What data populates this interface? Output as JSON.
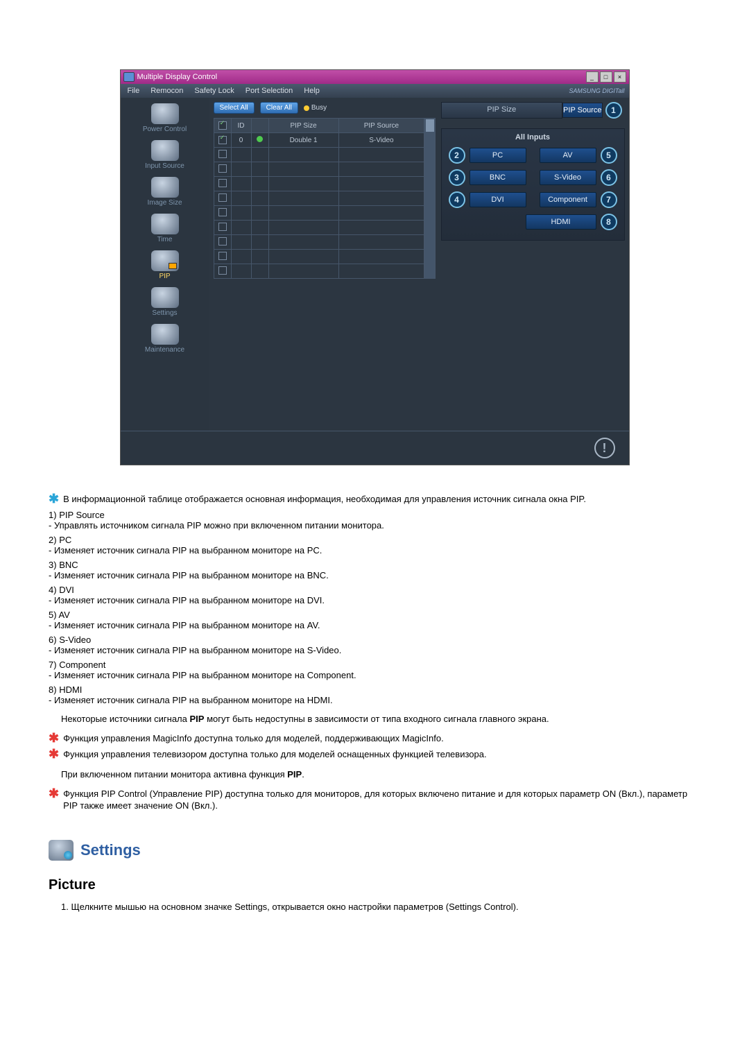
{
  "app_window": {
    "title": "Multiple Display Control",
    "menus": [
      "File",
      "Remocon",
      "Safety Lock",
      "Port Selection",
      "Help"
    ],
    "brand_logo": "SAMSUNG DIGITall",
    "top_buttons": {
      "select_all": "Select All",
      "clear_all": "Clear All",
      "busy": "Busy"
    },
    "sidebar": [
      {
        "label": "Power Control",
        "active": false
      },
      {
        "label": "Input Source",
        "active": false
      },
      {
        "label": "Image Size",
        "active": false
      },
      {
        "label": "Time",
        "active": false
      },
      {
        "label": "PIP",
        "active": true
      },
      {
        "label": "Settings",
        "active": false
      },
      {
        "label": "Maintenance",
        "active": false
      }
    ],
    "table": {
      "cols": [
        "",
        "ID",
        "",
        "PIP Size",
        "PIP Source"
      ],
      "rows": [
        {
          "checked": true,
          "id": "0",
          "status": "green",
          "pip_size": "Double 1",
          "pip_source": "S-Video"
        },
        {
          "checked": false,
          "id": "",
          "status": "",
          "pip_size": "",
          "pip_source": ""
        },
        {
          "checked": false,
          "id": "",
          "status": "",
          "pip_size": "",
          "pip_source": ""
        },
        {
          "checked": false,
          "id": "",
          "status": "",
          "pip_size": "",
          "pip_source": ""
        },
        {
          "checked": false,
          "id": "",
          "status": "",
          "pip_size": "",
          "pip_source": ""
        },
        {
          "checked": false,
          "id": "",
          "status": "",
          "pip_size": "",
          "pip_source": ""
        },
        {
          "checked": false,
          "id": "",
          "status": "",
          "pip_size": "",
          "pip_source": ""
        },
        {
          "checked": false,
          "id": "",
          "status": "",
          "pip_size": "",
          "pip_source": ""
        },
        {
          "checked": false,
          "id": "",
          "status": "",
          "pip_size": "",
          "pip_source": ""
        },
        {
          "checked": false,
          "id": "",
          "status": "",
          "pip_size": "",
          "pip_source": ""
        }
      ]
    },
    "tabs": {
      "pip_size": "PIP Size",
      "pip_source": "PIP Source"
    },
    "callouts": {
      "pip_source_tab": "1",
      "pc": "2",
      "bnc": "3",
      "dvi": "4",
      "av": "5",
      "svideo": "6",
      "component": "7",
      "hdmi": "8"
    },
    "inputs_panel": {
      "title": "All Inputs",
      "left": [
        "PC",
        "BNC",
        "DVI"
      ],
      "right": [
        "AV",
        "S-Video",
        "Component",
        "HDMI"
      ]
    }
  },
  "doc": {
    "intro_note": "В информационной таблице отображается основная информация, необходимая для управления источник сигнала окна PIP.",
    "items": [
      {
        "n": "1)",
        "title": "PIP Source",
        "desc": "- Управлять источником сигнала PIP можно при включенном питании монитора."
      },
      {
        "n": "2)",
        "title": "PC",
        "desc": "- Изменяет источник сигнала PIP на выбранном мониторе на PC."
      },
      {
        "n": "3)",
        "title": "BNC",
        "desc": "- Изменяет источник сигнала PIP на выбранном мониторе на BNC."
      },
      {
        "n": "4)",
        "title": "DVI",
        "desc": "- Изменяет источник сигнала PIP на выбранном мониторе на DVI."
      },
      {
        "n": "5)",
        "title": "AV",
        "desc": "- Изменяет источник сигнала PIP на выбранном мониторе на AV."
      },
      {
        "n": "6)",
        "title": "S-Video",
        "desc": "- Изменяет источник сигнала PIP на выбранном мониторе на S-Video."
      },
      {
        "n": "7)",
        "title": "Component",
        "desc": "- Изменяет источник сигнала PIP на выбранном мониторе на Component."
      },
      {
        "n": "8)",
        "title": "HDMI",
        "desc": "- Изменяет источник сигнала PIP на выбранном мониторе на HDMI."
      }
    ],
    "msg1_a": "Некоторые источники сигнала ",
    "msg1_b": "PIP",
    "msg1_c": " могут быть недоступны в зависимости от типа входного сигнала главного экрана.",
    "note2_a": "Функция управления ",
    "note2_b": "MagicInfo",
    "note2_c": " доступна только для моделей",
    "note2_d": ", поддерживающих",
    "note2_e": " MagicInfo.",
    "note3": "Функция управления телевизором доступна только для моделей оснащенных функцией телевизора.",
    "msg2_a": "При включенном питании монитора активна функция",
    "msg2_b": " PIP",
    "msg2_c": ".",
    "note4_a": "Функция ",
    "note4_b": "PIP Control (Управление PIP)",
    "note4_c": " доступна только для мониторов, для которых включено питание и для которых параметр",
    "note4_d": " ON (Вкл.),",
    "note4_e": " параметр ",
    "note4_f": "PIP",
    "note4_g": " также имеет значение",
    "note4_h": " ON (Вкл.).",
    "section_title": "Settings",
    "subhead": "Picture",
    "step1": "1. Щелкните мышью на основном значке Settings, открывается окно настройки параметров (Settings Control)."
  }
}
